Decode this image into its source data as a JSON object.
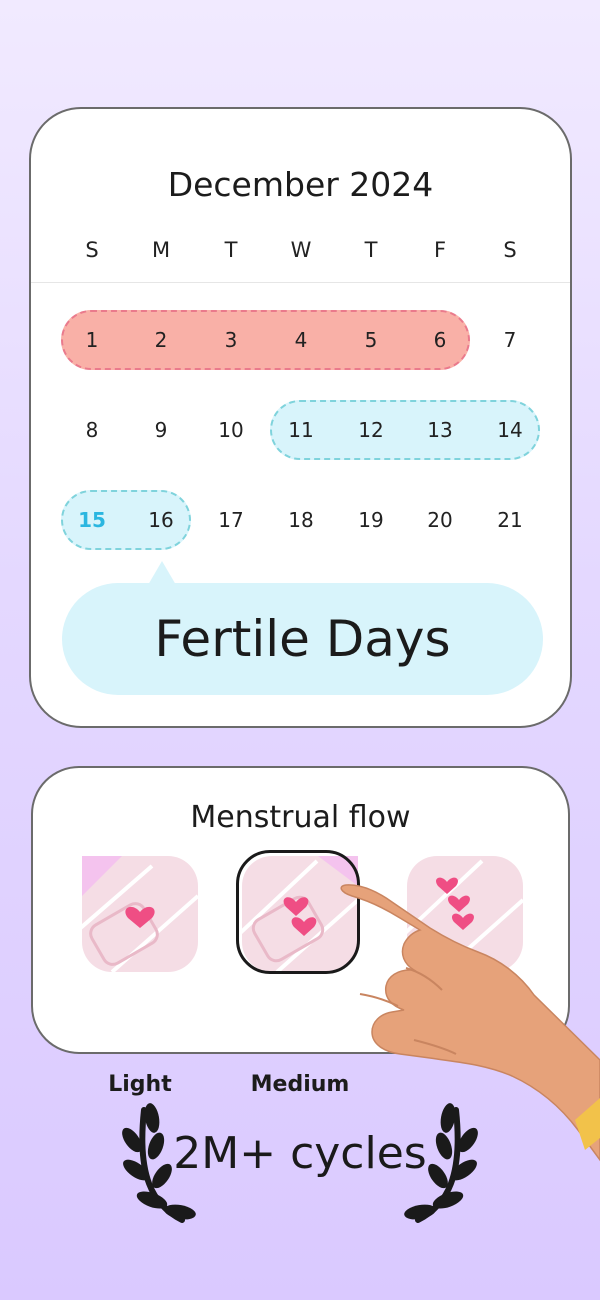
{
  "calendar": {
    "month_title": "December 2024",
    "weekdays": [
      "S",
      "M",
      "T",
      "W",
      "T",
      "F",
      "S"
    ],
    "weeks": [
      [
        "1",
        "2",
        "3",
        "4",
        "5",
        "6",
        "7"
      ],
      [
        "8",
        "9",
        "10",
        "11",
        "12",
        "13",
        "14"
      ],
      [
        "15",
        "16",
        "17",
        "18",
        "19",
        "20",
        "21"
      ]
    ],
    "period_days": [
      "1",
      "2",
      "3",
      "4",
      "5",
      "6"
    ],
    "fertile_days": [
      "11",
      "12",
      "13",
      "14",
      "15",
      "16"
    ],
    "highlighted_day": "15",
    "tooltip": "Fertile Days",
    "colors": {
      "period": "#f9b0a7",
      "fertile": "#d8f4fb",
      "highlight_text": "#2bb6e0"
    }
  },
  "flow": {
    "title": "Menstrual flow",
    "options": [
      {
        "label": "Light",
        "hearts": 1,
        "selected": false
      },
      {
        "label": "Medium",
        "hearts": 2,
        "selected": true
      },
      {
        "label": "",
        "hearts": 3,
        "selected": false
      }
    ]
  },
  "badge": {
    "text": "2M+ cycles",
    "icon": "laurel-wreath-icon"
  },
  "decoration": {
    "hand_icon": "pointing-hand-icon"
  }
}
